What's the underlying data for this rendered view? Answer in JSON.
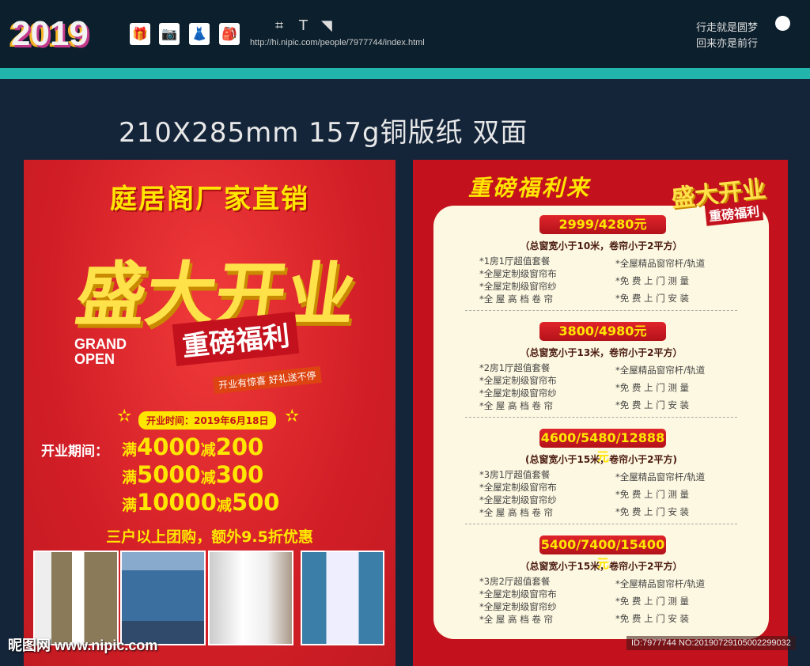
{
  "header": {
    "logo": "2019",
    "tools": [
      {
        "icon": "gift-icon",
        "glyph": "🎁"
      },
      {
        "icon": "camera-icon",
        "glyph": "📷"
      },
      {
        "icon": "dress-icon",
        "glyph": "👗"
      },
      {
        "icon": "backpack-icon",
        "glyph": "🎒"
      }
    ],
    "url": "http://hi.nipic.com/people/7977744/index.html",
    "motto_1": "行走就是圆梦",
    "motto_2": "回来亦是前行"
  },
  "spec": "210X285mm 157g铜版纸 双面",
  "left": {
    "title": "庭居阁厂家直销",
    "big": "盛大开业",
    "sub": "重磅福利",
    "grand": "GRAND",
    "open": "OPEN",
    "tagline": "开业有惊喜 好礼送不停",
    "date": "开业时间：2019年6月18日",
    "period": "开业期间：",
    "offers": [
      {
        "a": "满",
        "b": "4000",
        "c": "减",
        "d": "200"
      },
      {
        "a": "满",
        "b": "5000",
        "c": "减",
        "d": "300"
      },
      {
        "a": "满",
        "b": "10000",
        "c": "减",
        "d": "500"
      }
    ],
    "group": "三户以上团购，额外9.5折优惠"
  },
  "right": {
    "title": "重磅福利来",
    "badge": "盛大开业",
    "badge_sub": "重磅福利",
    "packages": [
      {
        "price": "2999/4280元",
        "cond": "（总窗宽小于10米，卷帘小于2平方）",
        "left": [
          "*1房1厅超值套餐",
          "*全屋定制级窗帘布",
          "*全屋定制级窗帘纱",
          "*全 屋 高 档 卷 帘"
        ],
        "right": [
          "*全屋精品窗帘杆/轨道",
          "*免 费 上 门 测 量",
          "*免 费 上 门 安 装"
        ]
      },
      {
        "price": "3800/4980元",
        "cond": "（总窗宽小于13米，卷帘小于2平方）",
        "left": [
          "*2房1厅超值套餐",
          "*全屋定制级窗帘布",
          "*全屋定制级窗帘纱",
          "*全 屋 高 档 卷 帘"
        ],
        "right": [
          "*全屋精品窗帘杆/轨道",
          "*免 费 上 门 测 量",
          "*免 费 上 门 安 装"
        ]
      },
      {
        "price": "4600/5480/12888元",
        "cond": "(总窗宽小于15米，卷帘小于2平方)",
        "left": [
          "*3房1厅超值套餐",
          "*全屋定制级窗帘布",
          "*全屋定制级窗帘纱",
          "*全 屋 高 档 卷 帘"
        ],
        "right": [
          "*全屋精品窗帘杆/轨道",
          "*免 费 上 门 测 量",
          "*免 费 上 门 安 装"
        ]
      },
      {
        "price": "5400/7400/15400元",
        "cond": "（总窗宽小于15米，卷帘小于2平方）",
        "left": [
          "*3房2厅超值套餐",
          "*全屋定制级窗帘布",
          "*全屋定制级窗帘纱",
          "*全 屋 高 档 卷 帘"
        ],
        "right": [
          "*全屋精品窗帘杆/轨道",
          "*免 费 上 门 测 量",
          "*免 费 上 门 安 装"
        ]
      }
    ]
  },
  "watermark": "昵图网 www.nipic.com",
  "image_id": "ID:7977744 NO:20190729105002299032"
}
